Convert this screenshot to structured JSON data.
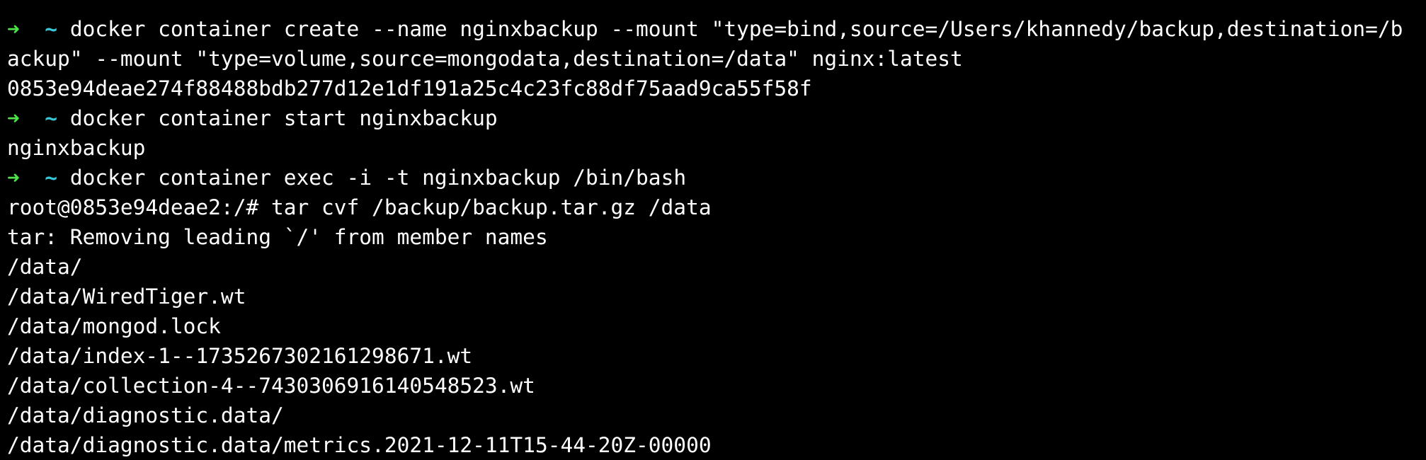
{
  "colors": {
    "background": "#000000",
    "foreground": "#ffffff",
    "prompt_arrow": "#4fe34a",
    "prompt_dir": "#35c8d8"
  },
  "prompt": {
    "arrow_icon": "right-arrow-icon",
    "arrow": "➜",
    "dir": "~"
  },
  "session": {
    "cmd1_line1": "docker container create --name nginxbackup --mount \"type=bind,source=/Users/khannedy/backup,destination=/b",
    "cmd1_line2": "ackup\" --mount \"type=volume,source=mongodata,destination=/data\" nginx:latest",
    "out1": "0853e94deae274f88488bdb277d12e1df191a25c4c23fc88df75aad9ca55f58f",
    "cmd2": "docker container start nginxbackup",
    "out2": "nginxbackup",
    "cmd3": "docker container exec -i -t nginxbackup /bin/bash",
    "shell_line": "root@0853e94deae2:/# tar cvf /backup/backup.tar.gz /data",
    "tar_lines": [
      "tar: Removing leading `/' from member names",
      "/data/",
      "/data/WiredTiger.wt",
      "/data/mongod.lock",
      "/data/index-1--1735267302161298671.wt",
      "/data/collection-4--7430306916140548523.wt",
      "/data/diagnostic.data/",
      "/data/diagnostic.data/metrics.2021-12-11T15-44-20Z-00000"
    ]
  }
}
